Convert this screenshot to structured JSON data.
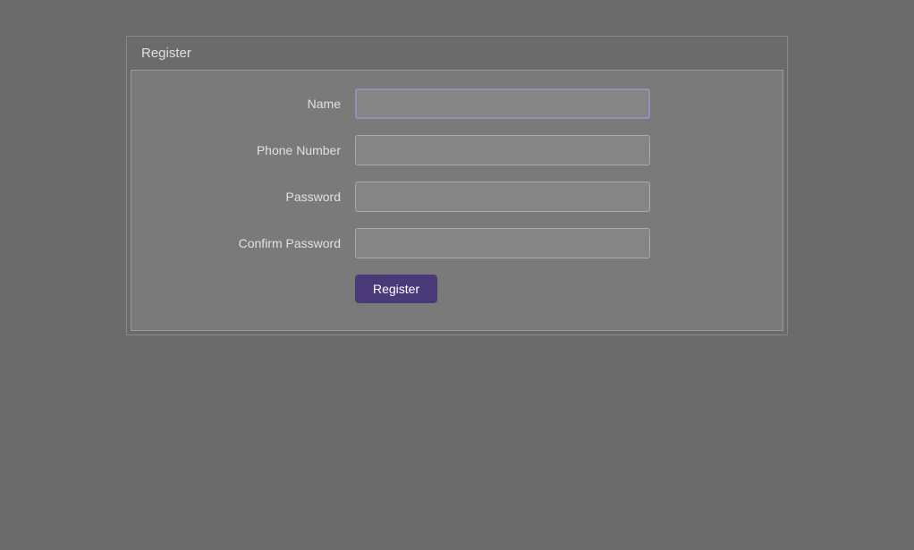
{
  "page": {
    "title": "Register",
    "form": {
      "title": "Register",
      "fields": [
        {
          "id": "name",
          "label": "Name",
          "type": "text",
          "placeholder": ""
        },
        {
          "id": "phone",
          "label": "Phone Number",
          "type": "text",
          "placeholder": ""
        },
        {
          "id": "password",
          "label": "Password",
          "type": "password",
          "placeholder": ""
        },
        {
          "id": "confirm_password",
          "label": "Confirm Password",
          "type": "password",
          "placeholder": ""
        }
      ],
      "submit_label": "Register"
    }
  }
}
